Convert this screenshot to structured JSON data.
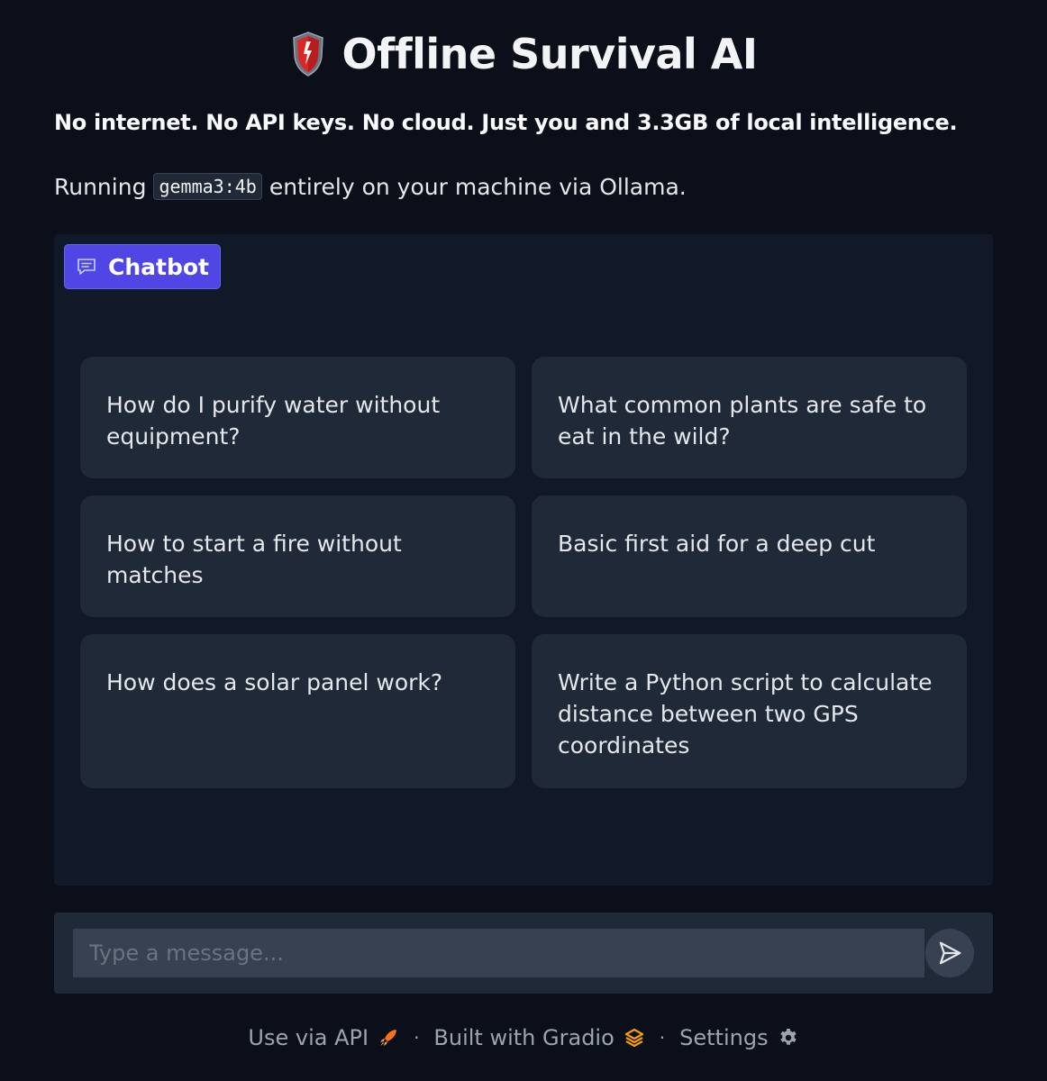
{
  "header": {
    "title": "Offline Survival AI",
    "icon": "shield-icon",
    "tagline": "No internet. No API keys. No cloud. Just you and 3.3GB of local intelligence.",
    "running_prefix": "Running",
    "model_name": "gemma3:4b",
    "running_suffix": "entirely on your machine via Ollama."
  },
  "chatbot": {
    "label": "Chatbot",
    "icon": "chat-icon",
    "examples": [
      "How do I purify water without equipment?",
      "What common plants are safe to eat in the wild?",
      "How to start a fire without matches",
      "Basic first aid for a deep cut",
      "How does a solar panel work?",
      "Write a Python script to calculate distance between two GPS coordinates"
    ]
  },
  "composer": {
    "placeholder": "Type a message...",
    "send_icon": "send-icon"
  },
  "footer": {
    "api_label": "Use via API",
    "gradio_label": "Built with Gradio",
    "settings_label": "Settings",
    "separator": "·"
  },
  "colors": {
    "background": "#0b0f19",
    "panel": "#111827",
    "card": "#1f2937",
    "accent": "#4f46e5",
    "api_icon": "#f97316",
    "gradio_icon": "#f59e0b"
  }
}
